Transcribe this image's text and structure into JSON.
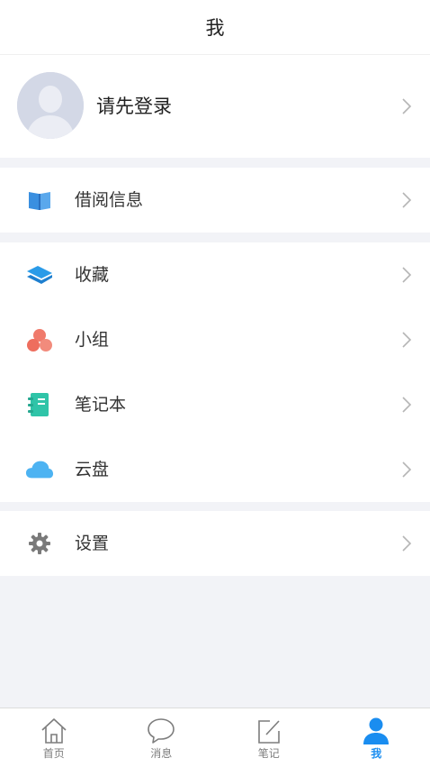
{
  "header": {
    "title": "我"
  },
  "profile": {
    "name": "请先登录"
  },
  "groups": [
    {
      "items": [
        {
          "label": "借阅信息",
          "icon": "book-icon"
        }
      ]
    },
    {
      "items": [
        {
          "label": "收藏",
          "icon": "collection-layers-icon"
        },
        {
          "label": "小组",
          "icon": "group-circles-icon"
        },
        {
          "label": "笔记本",
          "icon": "notebook-icon"
        },
        {
          "label": "云盘",
          "icon": "cloud-icon"
        }
      ]
    },
    {
      "items": [
        {
          "label": "设置",
          "icon": "gear-icon"
        }
      ]
    }
  ],
  "tabbar": {
    "items": [
      {
        "label": "首页",
        "icon": "home-icon",
        "active": false
      },
      {
        "label": "消息",
        "icon": "message-bubble-icon",
        "active": false
      },
      {
        "label": "笔记",
        "icon": "note-edit-icon",
        "active": false
      },
      {
        "label": "我",
        "icon": "person-icon",
        "active": true
      }
    ]
  },
  "colors": {
    "accent": "#1a8df0",
    "background": "#f2f3f7",
    "book": "#3a8fe0",
    "layers": "#2a9be8",
    "circles": "#f07a6b",
    "notebook": "#2fc4a8",
    "cloud": "#4db3f2",
    "gear": "#7a7a7a"
  }
}
